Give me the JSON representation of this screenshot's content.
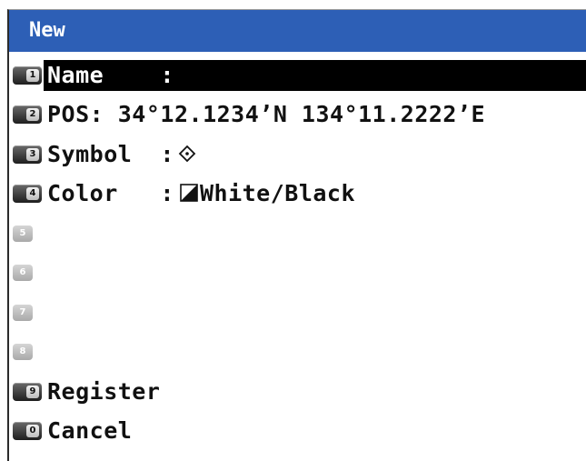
{
  "window": {
    "title": "New"
  },
  "menu": {
    "items": [
      {
        "key": "1",
        "label": "Name    :",
        "selected": true
      },
      {
        "key": "2",
        "label": "POS: 34°12.1234’N 134°11.2222’E"
      },
      {
        "key": "3",
        "label": "Symbol  :",
        "icon": "diamond-dot-icon"
      },
      {
        "key": "4",
        "label": "Color   :",
        "value": "White/Black",
        "icon": "half-triangle-color-icon"
      },
      {
        "key": "5",
        "label": ""
      },
      {
        "key": "6",
        "label": ""
      },
      {
        "key": "7",
        "label": ""
      },
      {
        "key": "8",
        "label": ""
      },
      {
        "key": "9",
        "label": "Register"
      },
      {
        "key": "0",
        "label": "Cancel"
      }
    ]
  },
  "colors": {
    "title_bar": "#2d5fb6",
    "selected_bg": "#000000",
    "text": "#111111",
    "key_dark": "#1e1e1e",
    "key_disabled": "#bdbdbd"
  }
}
